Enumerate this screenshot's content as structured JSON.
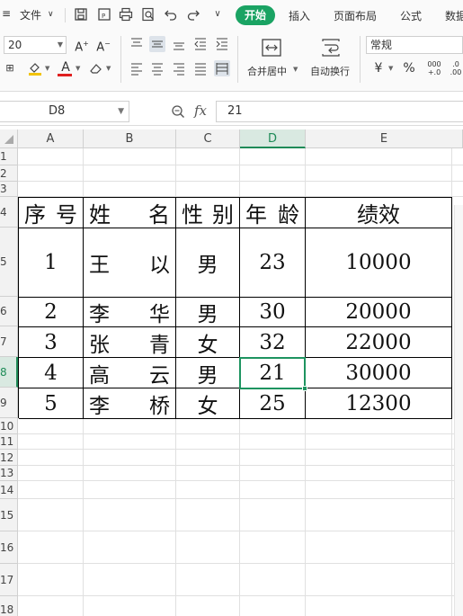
{
  "toolbar": {
    "file_menu": "文件",
    "tabs": [
      "开始",
      "插入",
      "页面布局",
      "公式",
      "数据"
    ],
    "font_size": "20",
    "number_format": "常规",
    "merge_center_label": "合并居中",
    "wrap_text_label": "自动换行",
    "currency_symbol": "¥",
    "percent_symbol": "%",
    "accent_color": "#1aa363"
  },
  "formula_bar": {
    "name_box": "D8",
    "fx": "fx",
    "value": "21"
  },
  "sheet": {
    "columns": [
      "A",
      "B",
      "C",
      "D",
      "E"
    ],
    "selected_column": "D",
    "rows": [
      "1",
      "2",
      "3",
      "4",
      "5",
      "6",
      "7",
      "8",
      "9",
      "10",
      "11",
      "12",
      "13",
      "14",
      "15",
      "16",
      "17",
      "18"
    ],
    "selected_row": "8",
    "table": {
      "headers": {
        "seq": [
          "序",
          "号"
        ],
        "name": [
          "姓",
          "名"
        ],
        "gender": [
          "性",
          "别"
        ],
        "age": [
          "年",
          "龄"
        ],
        "perf": "绩效"
      },
      "records": [
        {
          "seq": "1",
          "name": [
            "王",
            "以"
          ],
          "gender": "男",
          "age": "23",
          "perf": "10000"
        },
        {
          "seq": "2",
          "name": [
            "李",
            "华"
          ],
          "gender": "男",
          "age": "30",
          "perf": "20000"
        },
        {
          "seq": "3",
          "name": [
            "张",
            "青"
          ],
          "gender": "女",
          "age": "32",
          "perf": "22000"
        },
        {
          "seq": "4",
          "name": [
            "高",
            "云"
          ],
          "gender": "男",
          "age": "21",
          "perf": "30000"
        },
        {
          "seq": "5",
          "name": [
            "李",
            "桥"
          ],
          "gender": "女",
          "age": "25",
          "perf": "12300"
        }
      ]
    }
  }
}
